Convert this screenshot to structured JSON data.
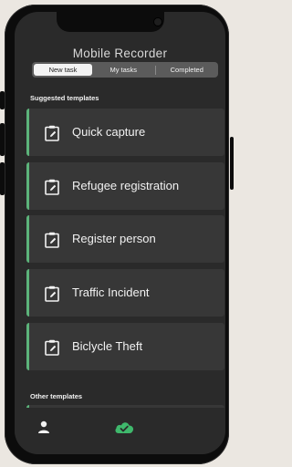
{
  "app": {
    "title": "Mobile Recorder"
  },
  "tabs": [
    {
      "label": "New task",
      "active": true
    },
    {
      "label": "My tasks",
      "active": false
    },
    {
      "label": "Completed",
      "active": false
    }
  ],
  "sections": {
    "suggested": "Suggested templates",
    "other": "Other templates"
  },
  "templates": [
    {
      "label": "Quick capture",
      "icon": "clipboard-edit-icon"
    },
    {
      "label": "Refugee registration",
      "icon": "clipboard-edit-icon"
    },
    {
      "label": "Register person",
      "icon": "clipboard-edit-icon"
    },
    {
      "label": "Traffic Incident",
      "icon": "clipboard-edit-icon"
    },
    {
      "label": "Biclycle Theft",
      "icon": "clipboard-edit-icon"
    }
  ],
  "nav": {
    "profile_icon": "person-icon",
    "sync_icon": "cloud-check-icon"
  },
  "colors": {
    "accent": "#5cb37a",
    "screen_bg": "#2a2a2a",
    "card_bg": "#373737"
  }
}
